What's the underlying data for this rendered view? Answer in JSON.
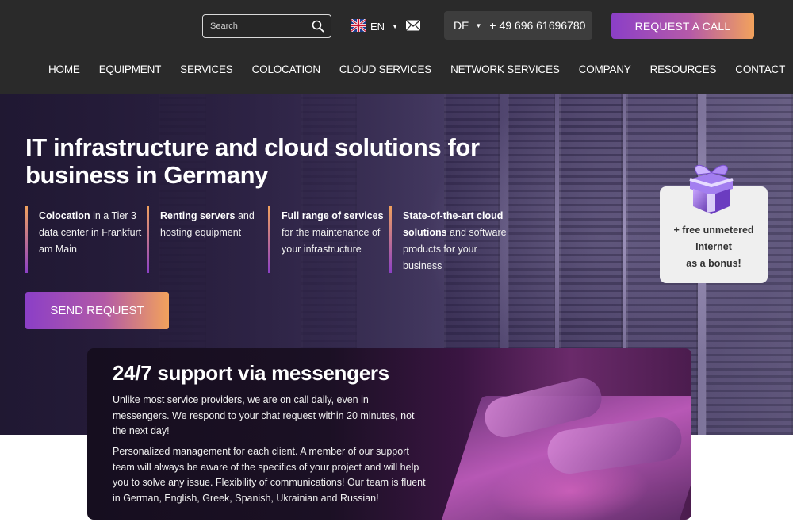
{
  "header": {
    "search": {
      "placeholder": "Search",
      "value": ""
    },
    "language": {
      "code": "EN",
      "flag": "uk-flag-icon"
    },
    "phone": {
      "region": "DE",
      "number": "+ 49 696 61696780"
    },
    "request_call_label": "REQUEST A CALL"
  },
  "nav": {
    "items": [
      {
        "label": "HOME"
      },
      {
        "label": "EQUIPMENT"
      },
      {
        "label": "SERVICES"
      },
      {
        "label": "COLOCATION"
      },
      {
        "label": "CLOUD SERVICES"
      },
      {
        "label": "NETWORK SERVICES"
      },
      {
        "label": "COMPANY"
      },
      {
        "label": "RESOURCES"
      },
      {
        "label": "CONTACT"
      }
    ]
  },
  "hero": {
    "title_line1": "IT infrastructure and cloud solutions for",
    "title_line2": "business in Germany",
    "features": [
      {
        "bold": "Colocation",
        "text": " in a Tier 3 data center in Frankfurt am Main"
      },
      {
        "bold": "Renting servers",
        "text": " and hosting equipment"
      },
      {
        "bold": "Full range of services",
        "text": " for the maintenance of your infrastructure"
      },
      {
        "bold": "State-of-the-art cloud solutions",
        "text": " and software products for your business"
      }
    ],
    "send_request_label": "SEND REQUEST",
    "bonus": {
      "line1": "+ free unmetered",
      "line2": "Internet",
      "line3": "as a bonus!"
    }
  },
  "support": {
    "title": "24/7 support via messengers",
    "paragraph1": "Unlike most service providers, we are on call daily, even in messengers. We respond to your chat request within 20 minutes, not the next day!",
    "paragraph2": "Personalized management for each client. A member of our support team will always be aware of the specifics of your project and will help you to solve any issue. Flexibility of communications! Our team is fluent in German, English, Greek, Spanish, Ukrainian and Russian!"
  },
  "colors": {
    "header_bg": "#2a2a2a",
    "gradient_start": "#8b3fc7",
    "gradient_end": "#f2a25c"
  }
}
